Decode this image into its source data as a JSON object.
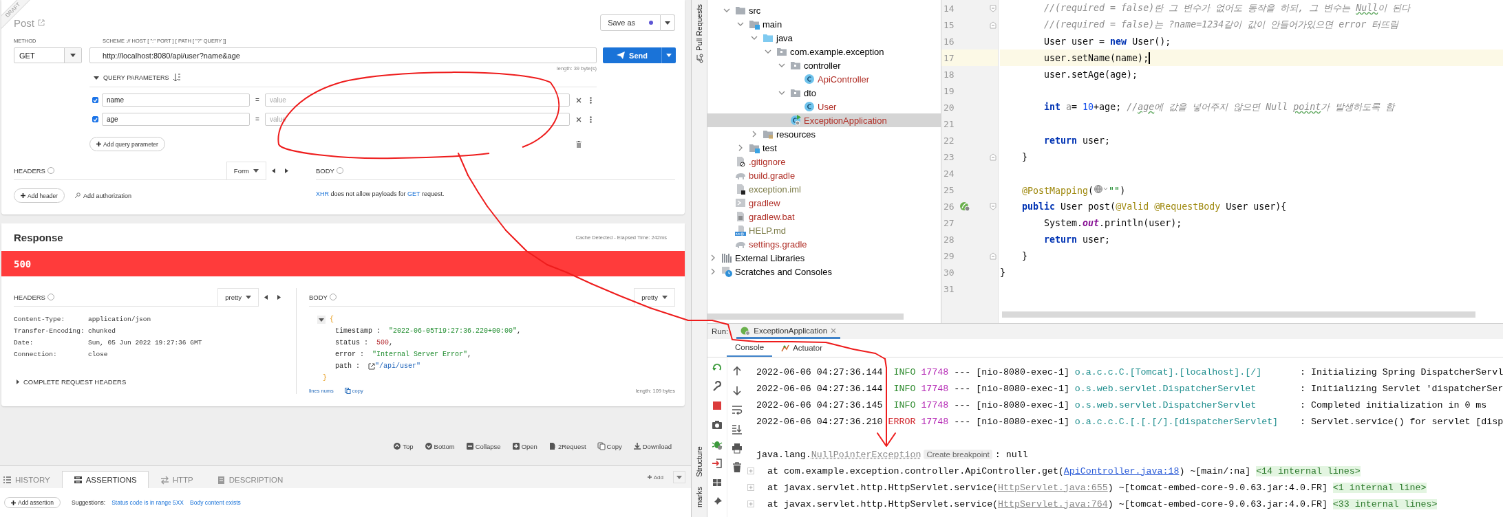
{
  "request": {
    "badge": "DRAFT",
    "title": "Post",
    "save_button": "Save as",
    "method_label": "METHOD",
    "url_label": "SCHEME :// HOST [ \":\" PORT ] [ PATH [ \"?\" QUERY ]]",
    "method": "GET",
    "url": "http://localhost:8080/api/user?name&age",
    "send_button": "Send",
    "length": "length: 39 byte(s)",
    "query_title": "QUERY PARAMETERS",
    "params": [
      {
        "name": "name",
        "separator": "=",
        "placeholder": "value",
        "checked": true
      },
      {
        "name": "age",
        "separator": "=",
        "placeholder": "value",
        "checked": true
      }
    ],
    "add_param": "Add query parameter",
    "headers_title": "HEADERS",
    "headers_mode": "Form",
    "add_header": "Add header",
    "add_auth": "Add authorization",
    "body_title": "BODY",
    "body_note": [
      {
        "kind": "link",
        "text": "XHR"
      },
      {
        "kind": "text",
        "text": " does not allow payloads for "
      },
      {
        "kind": "link",
        "text": "GET"
      },
      {
        "kind": "text",
        "text": " request."
      }
    ]
  },
  "response": {
    "title": "Response",
    "timing": "Cache Detected - Elapsed Time: 242ms",
    "status": "500",
    "headers_title": "HEADERS",
    "headers_mode": "pretty",
    "headers": [
      {
        "key": "Content-Type:",
        "value": "application/json"
      },
      {
        "key": "Transfer-Encoding:",
        "value": "chunked"
      },
      {
        "key": "Date:",
        "value": "Sun, 05 Jun 2022 19:27:36 GMT"
      },
      {
        "key": "Connection:",
        "value": "close"
      }
    ],
    "complete_headers": "COMPLETE REQUEST HEADERS",
    "body_title": "BODY",
    "body_mode": "pretty",
    "open": "{",
    "close": "}",
    "body": [
      {
        "key": "timestamp :",
        "value": "\"2022-06-05T19:27:36.220+00:00\"",
        "after": ",",
        "kind": "string"
      },
      {
        "key": "status :",
        "value": "500",
        "after": ",",
        "kind": "number"
      },
      {
        "key": "error :",
        "value": "\"Internal Server Error\"",
        "after": ",",
        "kind": "string"
      },
      {
        "key": "path :",
        "value": "\"/api/user\"",
        "kind": "link"
      }
    ],
    "lines_nums": "lines nums",
    "copy": "copy",
    "length": "length: 109 bytes"
  },
  "actions": [
    "Top",
    "Bottom",
    "Collapse",
    "Open",
    "2Request",
    "Copy",
    "Download"
  ],
  "tabs": [
    {
      "label": "HISTORY",
      "selected": false
    },
    {
      "label": "ASSERTIONS",
      "selected": true
    },
    {
      "label": "HTTP",
      "selected": false
    },
    {
      "label": "DESCRIPTION",
      "selected": false
    }
  ],
  "add_tab_button": "Add",
  "assertions": {
    "add": "Add assertion",
    "suggestions_label": "Suggestions:",
    "suggestions": [
      "Status code is in range 5XX",
      "Body content exists"
    ]
  },
  "ide": {
    "side_tools": {
      "top": "Pull Requests",
      "bottom": [
        "Structure",
        "marks"
      ]
    },
    "tree": [
      {
        "label": "src",
        "kind": "folder",
        "expanded": true,
        "selected": false,
        "children": [
          {
            "label": "main",
            "kind": "source-root",
            "expanded": true,
            "selected": false,
            "children": [
              {
                "label": "java",
                "kind": "java-root",
                "expanded": true,
                "selected": false,
                "children": [
                  {
                    "label": "com.example.exception",
                    "kind": "package",
                    "expanded": true,
                    "selected": false,
                    "children": [
                      {
                        "label": "controller",
                        "kind": "package",
                        "expanded": true,
                        "selected": false,
                        "children": [
                          {
                            "label": "ApiController",
                            "kind": "class",
                            "selected": false,
                            "color": "#b02e26"
                          }
                        ]
                      },
                      {
                        "label": "dto",
                        "kind": "package",
                        "expanded": true,
                        "selected": false,
                        "children": [
                          {
                            "label": "User",
                            "kind": "class",
                            "selected": false,
                            "color": "#b02e26"
                          }
                        ]
                      },
                      {
                        "label": "ExceptionApplication",
                        "kind": "main-class",
                        "selected": true,
                        "color": "#b02e26"
                      }
                    ]
                  }
                ]
              },
              {
                "label": "resources",
                "kind": "resources",
                "expanded": false,
                "selected": false
              }
            ]
          },
          {
            "label": "test",
            "kind": "source-root",
            "expanded": false,
            "selected": false
          }
        ]
      },
      {
        "label": ".gitignore",
        "kind": "gitignore",
        "selected": false,
        "color": "#b02e26"
      },
      {
        "label": "build.gradle",
        "kind": "gradle",
        "selected": false,
        "color": "#b02e26"
      },
      {
        "label": "exception.iml",
        "kind": "iml",
        "selected": false,
        "color": "#7a7a45"
      },
      {
        "label": "gradlew",
        "kind": "script",
        "selected": false,
        "color": "#b02e26"
      },
      {
        "label": "gradlew.bat",
        "kind": "bat",
        "selected": false,
        "color": "#b02e26"
      },
      {
        "label": "HELP.md",
        "kind": "markdown",
        "selected": false,
        "color": "#7a7a45"
      },
      {
        "label": "settings.gradle",
        "kind": "gradle",
        "selected": false,
        "color": "#b02e26"
      }
    ],
    "tree_roots": [
      {
        "label": "External Libraries",
        "kind": "libraries",
        "expanded": false,
        "selected": false
      },
      {
        "label": "Scratches and Consoles",
        "kind": "scratches",
        "expanded": false,
        "selected": false
      }
    ],
    "code": [
      {
        "num": "14",
        "kind": "body",
        "fold": {
          "kind": "start"
        },
        "tokens": [
          {
            "kind": "comment",
            "text": "//(required = false)란 그 변수가 없어도 동작을 하되, 그 변수는 "
          },
          {
            "kind": "typo",
            "text": "Null"
          },
          {
            "kind": "comment",
            "text": "이 된다"
          }
        ]
      },
      {
        "num": "15",
        "kind": "body",
        "fold": {
          "kind": "end"
        },
        "tokens": [
          {
            "kind": "comment",
            "text": "//(required = false)는 ?name=1234같이 값이 안들어가있으면 error 터뜨림"
          }
        ]
      },
      {
        "num": "16",
        "kind": "body",
        "tokens": [
          {
            "kind": "plain",
            "text": "User user = "
          },
          {
            "kind": "keyword",
            "text": "new"
          },
          {
            "kind": "plain",
            "text": " User();"
          }
        ]
      },
      {
        "num": "17",
        "kind": "body",
        "current": true,
        "tokens": [
          {
            "kind": "plain",
            "text": "user.setName(name);"
          }
        ]
      },
      {
        "num": "18",
        "kind": "body",
        "tokens": [
          {
            "kind": "plain",
            "text": "user.setAge(age);"
          }
        ]
      },
      {
        "num": "19"
      },
      {
        "num": "20",
        "kind": "body",
        "tokens": [
          {
            "kind": "keyword",
            "text": "int"
          },
          {
            "kind": "unused",
            "text": " a"
          },
          {
            "kind": "plain",
            "text": "= "
          },
          {
            "kind": "number",
            "text": "10"
          },
          {
            "kind": "plain",
            "text": "+age; "
          },
          {
            "kind": "comment",
            "text": "//"
          },
          {
            "kind": "typo",
            "text": "age"
          },
          {
            "kind": "comment",
            "text": "에 값을 넣어주지 않으면 Null "
          },
          {
            "kind": "typo",
            "text": "point"
          },
          {
            "kind": "comment",
            "text": "가 발생하도록 함"
          }
        ]
      },
      {
        "num": "21"
      },
      {
        "num": "22",
        "kind": "body",
        "tokens": [
          {
            "kind": "keyword",
            "text": "return"
          },
          {
            "kind": "plain",
            "text": " user;"
          }
        ]
      },
      {
        "num": "23",
        "kind": "member",
        "fold": {
          "kind": "end"
        },
        "tokens": [
          {
            "kind": "plain",
            "text": "}"
          }
        ]
      },
      {
        "num": "24"
      },
      {
        "num": "25",
        "kind": "member",
        "tokens": [
          {
            "kind": "annotation",
            "text": "@PostMapping"
          },
          {
            "kind": "plain",
            "text": "("
          },
          {
            "kind": "globe-hint"
          },
          {
            "kind": "string",
            "text": "\"\""
          },
          {
            "kind": "plain",
            "text": ")"
          }
        ]
      },
      {
        "num": "26",
        "kind": "member",
        "fold": {
          "kind": "start"
        },
        "gutter": {
          "kind": "bean"
        },
        "tokens": [
          {
            "kind": "keyword",
            "text": "public"
          },
          {
            "kind": "plain",
            "text": " User post("
          },
          {
            "kind": "annotation",
            "text": "@Valid @RequestBody"
          },
          {
            "kind": "plain",
            "text": " User user){"
          }
        ]
      },
      {
        "num": "27",
        "kind": "body",
        "tokens": [
          {
            "kind": "plain",
            "text": "System."
          },
          {
            "kind": "field",
            "text": "out"
          },
          {
            "kind": "plain",
            "text": ".println(user);"
          }
        ]
      },
      {
        "num": "28",
        "kind": "body",
        "tokens": [
          {
            "kind": "keyword",
            "text": "return"
          },
          {
            "kind": "plain",
            "text": " user;"
          }
        ]
      },
      {
        "num": "29",
        "kind": "member",
        "fold": {
          "kind": "end"
        },
        "tokens": [
          {
            "kind": "plain",
            "text": "}"
          }
        ]
      },
      {
        "num": "30",
        "kind": "top",
        "tokens": [
          {
            "kind": "plain",
            "text": "}"
          }
        ]
      },
      {
        "num": "31"
      }
    ],
    "run": {
      "label": "Run:",
      "config": "ExceptionApplication",
      "tabs": [
        {
          "label": "Console",
          "selected": true
        },
        {
          "label": "Actuator",
          "selected": false
        }
      ],
      "logs": [
        {
          "time": "2022-06-06 04:27:36.144",
          "level": "INFO",
          "kind": "info",
          "pid": "17748",
          "sep": "---",
          "thread": "[nio-8080-exec-1]",
          "logger": "o.a.c.c.C.[Tomcat].[localhost].[/]",
          "message": ": Initializing Spring DispatcherServl"
        },
        {
          "time": "2022-06-06 04:27:36.144",
          "level": "INFO",
          "kind": "info",
          "pid": "17748",
          "sep": "---",
          "thread": "[nio-8080-exec-1]",
          "logger": "o.s.web.servlet.DispatcherServlet",
          "message": ": Initializing Servlet 'dispatcherSer"
        },
        {
          "time": "2022-06-06 04:27:36.145",
          "level": "INFO",
          "kind": "info",
          "pid": "17748",
          "sep": "---",
          "thread": "[nio-8080-exec-1]",
          "logger": "o.s.web.servlet.DispatcherServlet",
          "message": ": Completed initialization in 0 ms"
        },
        {
          "time": "2022-06-06 04:27:36.210",
          "level": "ERROR",
          "kind": "error",
          "pid": "17748",
          "sep": "---",
          "thread": "[nio-8080-exec-1]",
          "logger": "o.a.c.c.C.[.[.[/].[dispatcherServlet]",
          "message": ": Servlet.service() for servlet [disp"
        }
      ],
      "exception": {
        "prefix": "java.lang.",
        "name": "NullPointerException",
        "breakpoint": "Create breakpoint",
        "suffix": ": null"
      },
      "stack": [
        {
          "text": "at com.example.exception.controller.ApiController.get(",
          "link": "ApiController.java:18",
          "kind": "project",
          "after": ") ~[main/:na]",
          "folded": "<14 internal lines>"
        },
        {
          "text": "at javax.servlet.http.HttpServlet.service(",
          "link": "HttpServlet.java:655",
          "kind": "library",
          "after": ") ~[tomcat-embed-core-9.0.63.jar:4.0.FR]",
          "folded": "<1 internal line>"
        },
        {
          "text": "at javax.servlet.http.HttpServlet.service(",
          "link": "HttpServlet.java:764",
          "kind": "library",
          "after": ") ~[tomcat-embed-core-9.0.63.jar:4.0.FR]",
          "folded": "<33 internal lines>"
        }
      ]
    }
  }
}
